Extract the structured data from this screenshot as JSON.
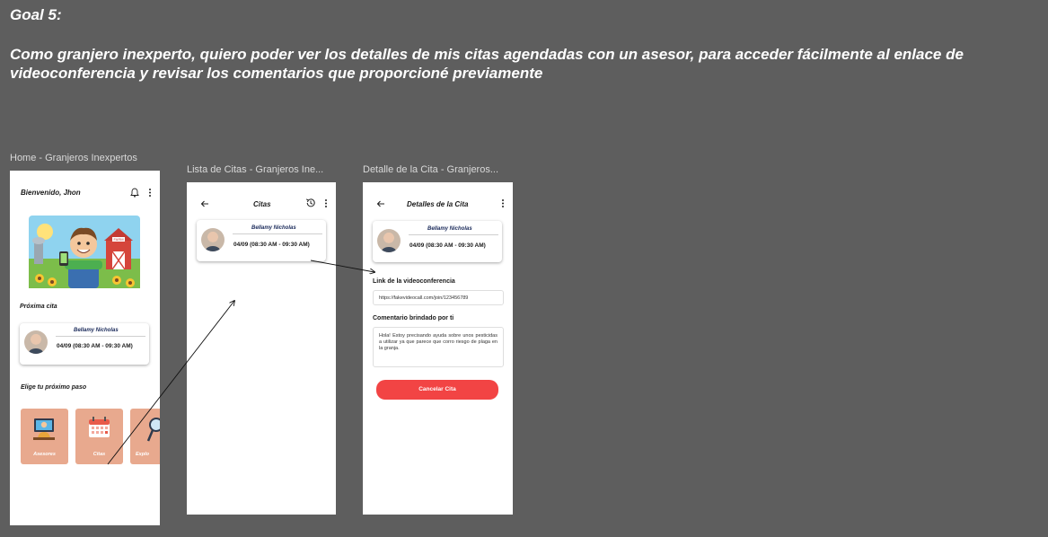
{
  "goal": {
    "title": "Goal 5:",
    "description": "Como granjero inexperto,  quiero poder ver los detalles de mis citas agendadas con un asesor, para acceder fácilmente al enlace de videoconferencia y revisar los comentarios que proporcioné previamente"
  },
  "frames": {
    "home": {
      "label": "Home - Granjeros Inexpertos",
      "greeting": "Bienvenido, Jhon",
      "banner_sign": "FARM",
      "next_appointment_label": "Próxima cita",
      "appointment": {
        "name": "Bellamy Nicholas",
        "time": "04/09 (08:30 AM - 09:30 AM)"
      },
      "next_step_label": "Elige tu próximo paso",
      "tiles": [
        {
          "label": "Asesores",
          "icon": "advisor-icon"
        },
        {
          "label": "Citas",
          "icon": "calendar-icon"
        },
        {
          "label": "Explo",
          "icon": "magnifier-icon"
        }
      ]
    },
    "list": {
      "label": "Lista de Citas - Granjeros Ine...",
      "title": "Citas",
      "appointment": {
        "name": "Bellamy Nicholas",
        "time": "04/09 (08:30 AM - 09:30 AM)"
      }
    },
    "detail": {
      "label": "Detalle de la Cita - Granjeros...",
      "title": "Detalles de la Cita",
      "appointment": {
        "name": "Bellamy Nicholas",
        "time": "04/09 (08:30 AM - 09:30 AM)"
      },
      "link_label": "Link de la videoconferencia",
      "link_value": "https://fakevideocall.com/join/123456789",
      "comment_label": "Comentario brindado por ti",
      "comment_value": "Hola! Estoy precisando ayuda sobre unos pesticidas a utilizar ya que parece que corro riesgo de plaga en la granja.",
      "cancel_label": "Cancelar Cita"
    }
  },
  "colors": {
    "canvas": "#5e5e5e",
    "tile": "#e8a98e",
    "cancel": "#f24444",
    "name_text": "#1a2a5a"
  }
}
